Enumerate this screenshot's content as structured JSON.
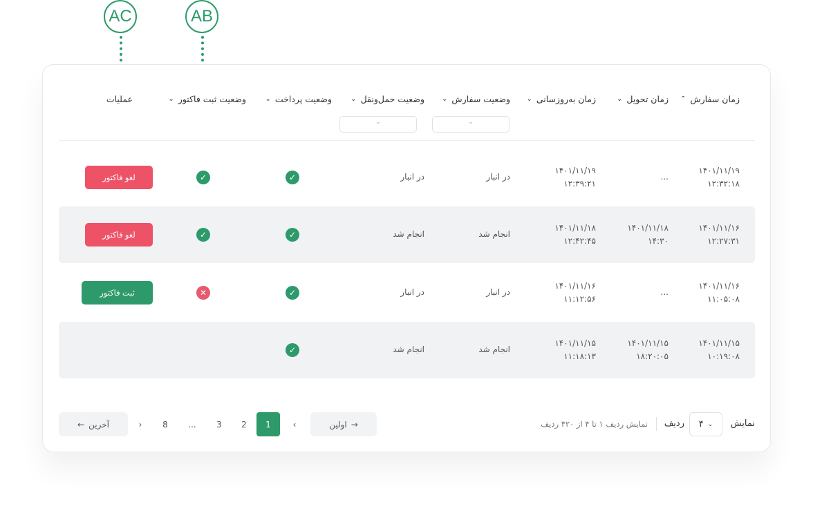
{
  "callouts": {
    "ac": "AC",
    "ab": "AB"
  },
  "headers": {
    "order_time": "زمان سفارش",
    "delivery_time": "زمان تحویل",
    "updated_time": "زمان به‌روزسانی",
    "order_status": "وضعیت سفارش",
    "shipping_status": "وضعیت حمل‌ونقل",
    "payment_status": "وضعیت پرداخت",
    "invoice_status": "وضعیت ثبت فاکتور",
    "actions": "عملیات"
  },
  "icons": {
    "chevron_up": "⌃",
    "chevron_down": "⌄",
    "check": "✓",
    "cross": "✕",
    "arrow_left": "←",
    "arrow_right": "→",
    "page_prev": "‹",
    "page_next": "›"
  },
  "colors": {
    "accent": "#2e9a6b",
    "danger": "#ee5267"
  },
  "rows": [
    {
      "order_date": "۱۴۰۱/۱۱/۱۹",
      "order_clock": "۱۲:۳۲:۱۸",
      "delivery": "...",
      "delivery_clock": "",
      "updated_date": "۱۴۰۱/۱۱/۱۹",
      "updated_clock": "۱۲:۳۹:۲۱",
      "order_status": "در انبار",
      "shipping_status": "در انبار",
      "payment": "ok",
      "invoice": "ok",
      "action": "لغو فاکتور"
    },
    {
      "order_date": "۱۴۰۱/۱۱/۱۶",
      "order_clock": "۱۲:۲۷:۳۱",
      "delivery": "۱۴۰۱/۱۱/۱۸",
      "delivery_clock": "۱۴:۳۰",
      "updated_date": "۱۴۰۱/۱۱/۱۸",
      "updated_clock": "۱۲:۴۲:۴۵",
      "order_status": "انجام شد",
      "shipping_status": "انجام شد",
      "payment": "ok",
      "invoice": "ok",
      "action": "لغو فاکتور"
    },
    {
      "order_date": "۱۴۰۱/۱۱/۱۶",
      "order_clock": "۱۱:۰۵:۰۸",
      "delivery": "...",
      "delivery_clock": "",
      "updated_date": "۱۴۰۱/۱۱/۱۶",
      "updated_clock": "۱۱:۱۲:۵۶",
      "order_status": "در انبار",
      "shipping_status": "در انبار",
      "payment": "ok",
      "invoice": "error",
      "action": "ثبت فاکتور"
    },
    {
      "order_date": "۱۴۰۱/۱۱/۱۵",
      "order_clock": "۱۰:۱۹:۰۸",
      "delivery": "۱۴۰۱/۱۱/۱۵",
      "delivery_clock": "۱۸:۲۰:۰۵",
      "updated_date": "۱۴۰۱/۱۱/۱۵",
      "updated_clock": "۱۱:۱۸:۱۳",
      "order_status": "انجام شد",
      "shipping_status": "انجام شد",
      "payment": "ok",
      "invoice": "",
      "action": ""
    }
  ],
  "pagination": {
    "show_label": "نمایش",
    "rows_value": "۴",
    "rows_label": "ردیف",
    "info": "نمایش ردیف ۱ تا ۴ از ۴۲۰ ردیف",
    "first": "اولین",
    "last": "آخرین",
    "pages": [
      "1",
      "2",
      "3",
      "...",
      "8"
    ],
    "active_page": "1"
  }
}
